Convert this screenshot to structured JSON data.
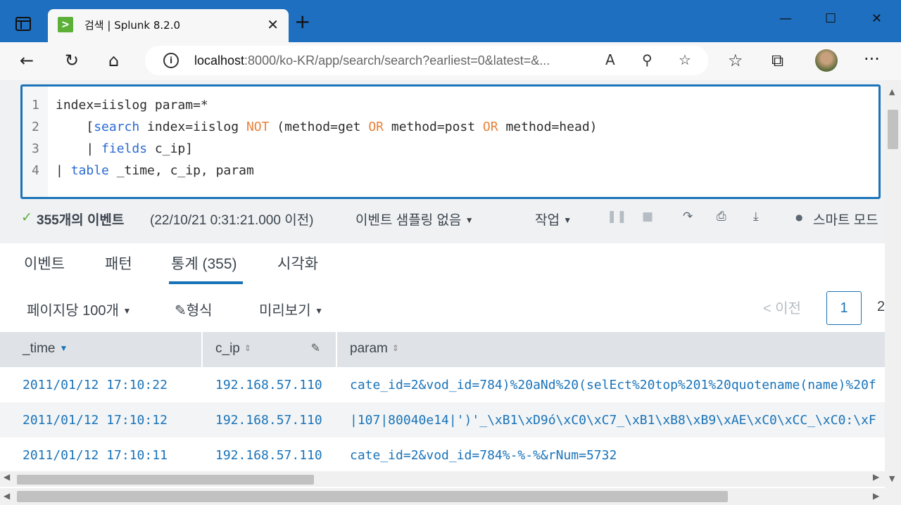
{
  "browser": {
    "tab_title": "검색 | Splunk 8.2.0",
    "favicon_text": ">",
    "url_host": "localhost",
    "url_rest": ":8000/ko-KR/app/search/search?earliest=0&latest=&...",
    "close_glyph": "✕",
    "new_tab_glyph": "+",
    "back_glyph": "←",
    "refresh_glyph": "↻",
    "home_glyph": "⌂",
    "info_glyph": "i",
    "read_aloud_glyph": "A",
    "zoom_glyph": "⚲",
    "fav_glyph": "☆",
    "favorites_glyph": "☆",
    "collections_glyph": "⧉",
    "menu_glyph": "···",
    "minimize_glyph": "—",
    "maximize_glyph": "☐",
    "window_close_glyph": "✕"
  },
  "query": {
    "lines": [
      {
        "num": "1",
        "parts": [
          {
            "t": "index=iislog param=*",
            "c": ""
          }
        ]
      },
      {
        "num": "2",
        "parts": [
          {
            "t": "    [",
            "c": ""
          },
          {
            "t": "search",
            "c": "kw"
          },
          {
            "t": " index=iislog ",
            "c": ""
          },
          {
            "t": "NOT",
            "c": "op"
          },
          {
            "t": " (method=get ",
            "c": ""
          },
          {
            "t": "OR",
            "c": "op"
          },
          {
            "t": " method=post ",
            "c": ""
          },
          {
            "t": "OR",
            "c": "op"
          },
          {
            "t": " method=head)",
            "c": ""
          }
        ]
      },
      {
        "num": "3",
        "parts": [
          {
            "t": "    | ",
            "c": ""
          },
          {
            "t": "fields",
            "c": "kw"
          },
          {
            "t": " c_ip]",
            "c": ""
          }
        ]
      },
      {
        "num": "4",
        "parts": [
          {
            "t": "| ",
            "c": ""
          },
          {
            "t": "table",
            "c": "kw"
          },
          {
            "t": " _time, c_ip, param",
            "c": ""
          }
        ]
      }
    ]
  },
  "status": {
    "check": "✓",
    "count": "355개의 이벤트",
    "time": "(22/10/21 0:31:21.000 이전)",
    "sampling": "이벤트 샘플링 없음",
    "job": "작업",
    "pause_glyph": "❚❚",
    "stop_glyph": "■",
    "share_glyph": "↷",
    "print_glyph": "⎙",
    "export_glyph": "⤓",
    "smart_mode": "스마트 모드",
    "bulb_glyph": "●"
  },
  "tabs": [
    {
      "label": "이벤트"
    },
    {
      "label": "패턴"
    },
    {
      "label": "통계 (355)"
    },
    {
      "label": "시각화"
    }
  ],
  "controls": {
    "per_page": "페이지당 100개",
    "format": "형식",
    "format_glyph": "✎",
    "preview": "미리보기",
    "prev": "< 이전",
    "page": "1",
    "next_page_partial": "2"
  },
  "table": {
    "columns": [
      "_time",
      "c_ip",
      "param"
    ],
    "sort_glyph": "⇕",
    "sort_active_glyph": "▼",
    "edit_glyph": "✎",
    "rows": [
      [
        "2011/01/12 17:10:22",
        "192.168.57.110",
        "cate_id=2&vod_id=784)%20aNd%20(selEct%20top%201%20quotename(name)%20f"
      ],
      [
        "2011/01/12 17:10:12",
        "192.168.57.110",
        "|107|80040e14|')'_\\xB1\\xD9ó\\xC0\\xC7_\\xB1\\xB8\\xB9\\xAE\\xC0\\xCC_\\xC0:\\xF"
      ],
      [
        "2011/01/12 17:10:11",
        "192.168.57.110",
        "cate_id=2&vod_id=784%-%-%&rNum=5732"
      ]
    ]
  },
  "accent_color": "#1a73b9",
  "browser_color": "#1e6fc0"
}
